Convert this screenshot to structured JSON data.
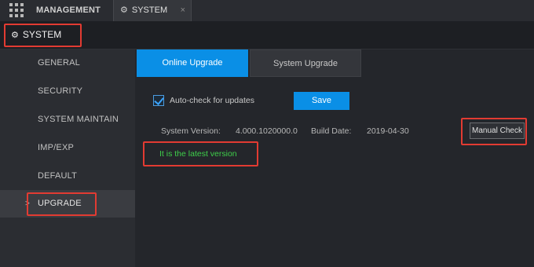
{
  "tabs": {
    "management": "MANAGEMENT",
    "system": "SYSTEM",
    "close": "×"
  },
  "section": {
    "title": "SYSTEM"
  },
  "sidebar": {
    "items": [
      {
        "label": "GENERAL"
      },
      {
        "label": "SECURITY"
      },
      {
        "label": "SYSTEM MAINTAIN"
      },
      {
        "label": "IMP/EXP"
      },
      {
        "label": "DEFAULT"
      },
      {
        "label": "UPGRADE",
        "active": true
      }
    ],
    "active_marker": ">"
  },
  "subtabs": {
    "online": "Online Upgrade",
    "system": "System Upgrade"
  },
  "auto_check": {
    "label": "Auto-check for updates",
    "checked": true
  },
  "save_label": "Save",
  "version": {
    "label": "System Version:",
    "value": "4.000.1020000.0",
    "build_label": "Build Date:",
    "build_value": "2019-04-30"
  },
  "manual_check_label": "Manual Check",
  "status_text": "It is the latest version",
  "colors": {
    "accent": "#0a8fe6",
    "highlight": "#e23b32",
    "success": "#3ecf4a"
  },
  "icons": {
    "grid": "grid-menu-icon",
    "gear": "gear-icon"
  }
}
